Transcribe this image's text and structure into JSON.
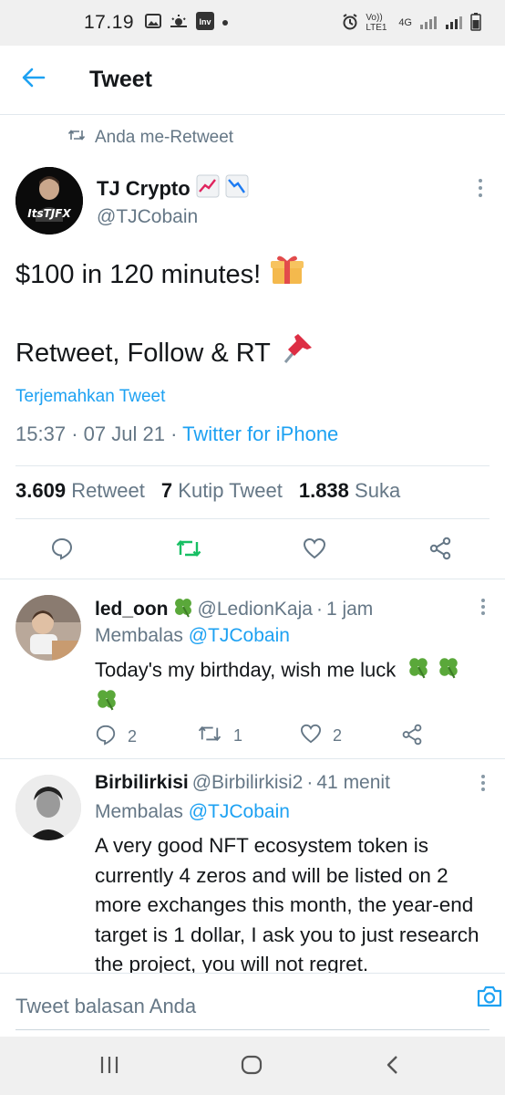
{
  "status_bar": {
    "time": "17.19",
    "network_label": "Vo)) LTE1",
    "network_type": "4G"
  },
  "header": {
    "title": "Tweet"
  },
  "retweet_banner": {
    "text": "Anda me-Retweet"
  },
  "tweet": {
    "author_name": "TJ Crypto",
    "author_handle": "@TJCobain",
    "avatar_text": "ItsTJFX",
    "line1": "$100 in 120 minutes!",
    "line2": "Retweet, Follow & RT",
    "translate_label": "Terjemahkan Tweet",
    "time": "15:37",
    "date": "07 Jul 21",
    "source": "Twitter for iPhone",
    "stats": {
      "retweets_count": "3.609",
      "retweets_label": "Retweet",
      "quotes_count": "7",
      "quotes_label": "Kutip Tweet",
      "likes_count": "1.838",
      "likes_label": "Suka"
    }
  },
  "replies": [
    {
      "name": "led_oon",
      "handle": "@LedionKaja",
      "time": "1 jam",
      "replying_label": "Membalas",
      "replying_to": "@TJCobain",
      "text": "Today's my birthday, wish me luck",
      "reply_count": "2",
      "retweet_count": "1",
      "like_count": "2"
    },
    {
      "name": "Birbilirkisi",
      "handle": "@Birbilirkisi2",
      "time": "41 menit",
      "replying_label": "Membalas",
      "replying_to": "@TJCobain",
      "text": "A very good NFT ecosystem token is currently 4 zeros and will be listed on 2 more exchanges this month, the year-end target is 1 dollar, I ask you to just research the project, you will not regret."
    }
  ],
  "composer": {
    "placeholder": "Tweet balasan Anda"
  },
  "colors": {
    "accent": "#1da1f2",
    "retweet_green": "#17bf63",
    "muted": "#657786"
  }
}
